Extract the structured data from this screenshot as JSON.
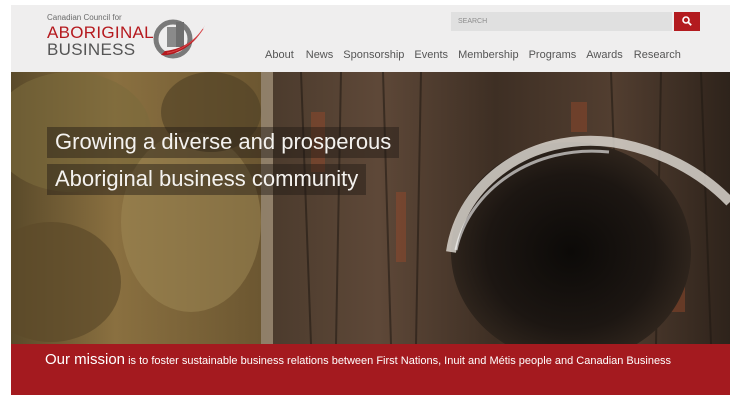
{
  "logo": {
    "small_text": "Canadian Council for",
    "line1": "ABORIGINAL",
    "line2": "BUSINESS"
  },
  "search": {
    "placeholder": "SEARCH"
  },
  "nav": [
    "About",
    "News",
    "Sponsorship",
    "Events",
    "Membership",
    "Programs",
    "Awards",
    "Research"
  ],
  "hero": {
    "line1": "Growing a diverse and prosperous",
    "line2": "Aboriginal business community"
  },
  "mission": {
    "lead": "Our mission",
    "text": " is to foster sustainable business relations between First Nations, Inuit and Métis people and Canadian Business"
  },
  "colors": {
    "brand_red": "#b5191e",
    "mission_bg": "#a41a1f",
    "header_bg": "#efeeee"
  },
  "icons": {
    "search": "search-icon",
    "logo": "logo-mark-icon"
  }
}
